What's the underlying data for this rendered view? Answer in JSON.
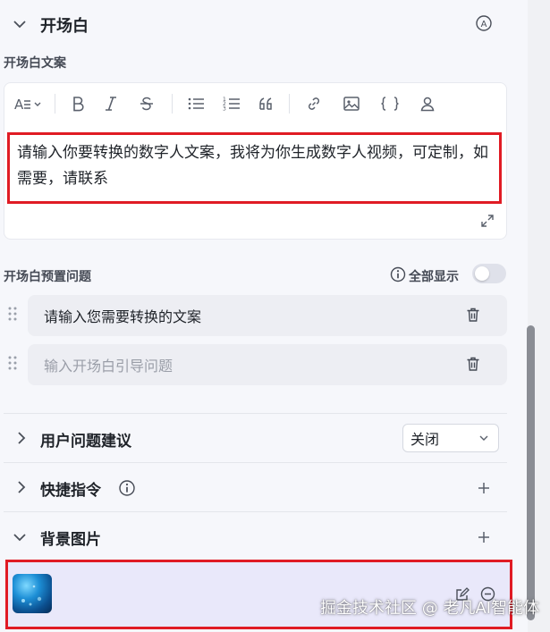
{
  "opening": {
    "title": "开场白",
    "text_label": "开场白文案",
    "editor_text": "请输入你要转换的数字人文案，我将为你生成数字人视频，可定制，如需要，请联系"
  },
  "preset": {
    "label": "开场白预置问题",
    "show_all": "全部显示",
    "rows": [
      {
        "text": "请输入您需要转换的文案"
      },
      {
        "placeholder": "输入开场白引导问题"
      }
    ]
  },
  "suggestions": {
    "title": "用户问题建议",
    "select_value": "关闭"
  },
  "shortcuts": {
    "title": "快捷指令"
  },
  "background": {
    "title": "背景图片"
  },
  "watermark": "掘金技术社区 @ 老凡AI智能体",
  "colors": {
    "highlight": "#e01b24",
    "accent": "#5b6cf6"
  }
}
